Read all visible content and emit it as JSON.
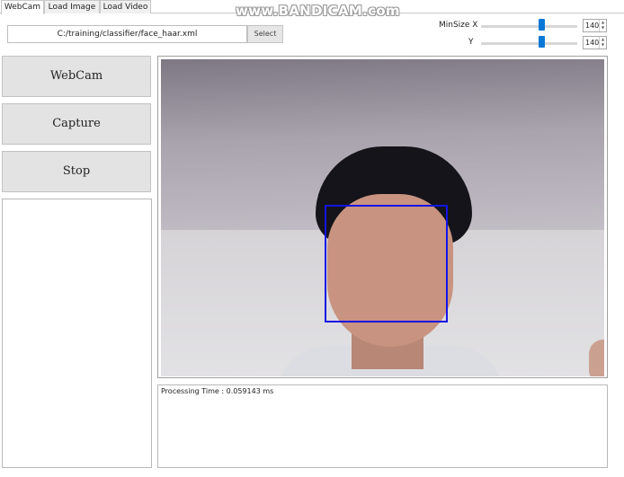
{
  "tabs": [
    "WebCam",
    "Load Image",
    "Load Video"
  ],
  "watermark": "www.BANDICAM.com",
  "classifier": {
    "path": "C:/training/classifier/face_haar.xml",
    "select_label": "Select"
  },
  "minsize": {
    "x_label": "MinSize X",
    "y_label": "Y",
    "x_value": "140",
    "y_value": "140"
  },
  "buttons": {
    "webcam": "WebCam",
    "capture": "Capture",
    "stop": "Stop"
  },
  "log": {
    "processing_time": "Processing Time : 0.059143 ms"
  },
  "colors": {
    "detection_box": "#1414e6",
    "slider_thumb": "#0a78d6"
  }
}
